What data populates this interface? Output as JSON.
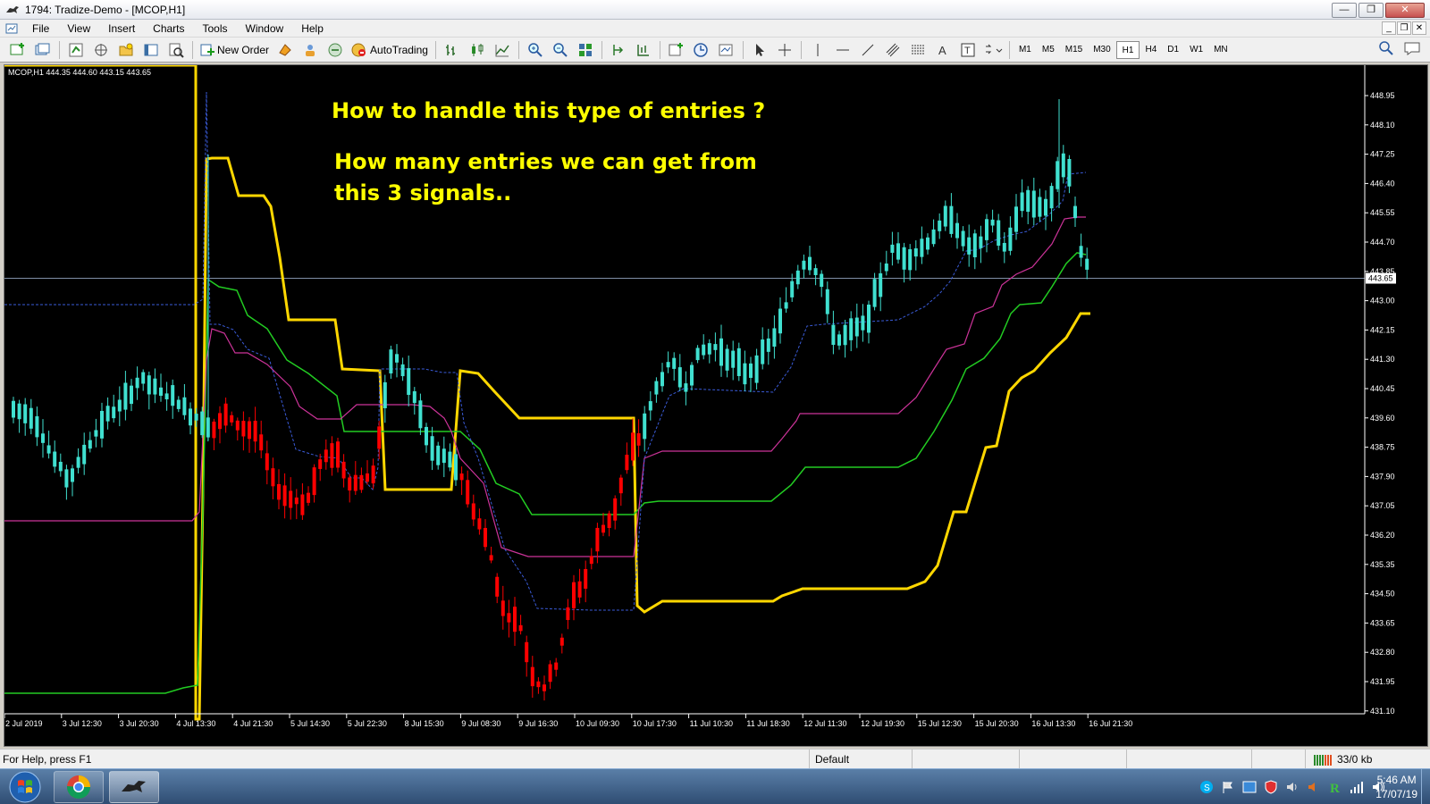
{
  "window": {
    "title": "1794: Tradize-Demo - [MCOP,H1]"
  },
  "menu": {
    "items": [
      "File",
      "View",
      "Insert",
      "Charts",
      "Tools",
      "Window",
      "Help"
    ]
  },
  "toolbar": {
    "new_order_label": "New Order",
    "autotrading_label": "AutoTrading",
    "timeframes": [
      "M1",
      "M5",
      "M15",
      "M30",
      "H1",
      "H4",
      "D1",
      "W1",
      "MN"
    ],
    "active_timeframe": "H1"
  },
  "chart": {
    "symbol_info": "MCOP,H1  444.35 444.60 443.15 443.65",
    "annotation_line1": "How to handle this type of entries ?",
    "annotation_line2": "How many entries we can get from",
    "annotation_line3": "this 3 signals..",
    "current_price_label": "443.65",
    "colors": {
      "background": "#000000",
      "bull": "#40e0d0",
      "bear": "#ff0000",
      "gold": "#ffd700",
      "green": "#22cc22",
      "magenta": "#cc3399",
      "blue": "#3a5bd8",
      "annotation": "#ffff00"
    }
  },
  "chart_data": {
    "type": "candlestick",
    "price_ticks": [
      "448.95",
      "448.10",
      "447.25",
      "446.40",
      "445.55",
      "444.70",
      "443.85",
      "443.00",
      "442.15",
      "441.30",
      "440.45",
      "439.60",
      "438.75",
      "437.90",
      "437.05",
      "436.20",
      "435.35",
      "434.50",
      "433.65",
      "432.80",
      "431.95",
      "431.10"
    ],
    "time_ticks": [
      "2 Jul 2019",
      "3 Jul 12:30",
      "3 Jul 20:30",
      "4 Jul 13:30",
      "4 Jul 21:30",
      "5 Jul 14:30",
      "5 Jul 22:30",
      "8 Jul 15:30",
      "9 Jul 08:30",
      "9 Jul 16:30",
      "10 Jul 09:30",
      "10 Jul 17:30",
      "11 Jul 10:30",
      "11 Jul 18:30",
      "12 Jul 11:30",
      "12 Jul 19:30",
      "15 Jul 12:30",
      "15 Jul 20:30",
      "16 Jul 13:30",
      "16 Jul 21:30"
    ],
    "ylim": [
      431.1,
      448.95
    ],
    "current_price": 443.65
  },
  "status": {
    "help_text": "For Help, press F1",
    "profile": "Default",
    "connection": "33/0 kb"
  },
  "clock": {
    "time": "5:46 AM",
    "date": "17/07/19"
  }
}
